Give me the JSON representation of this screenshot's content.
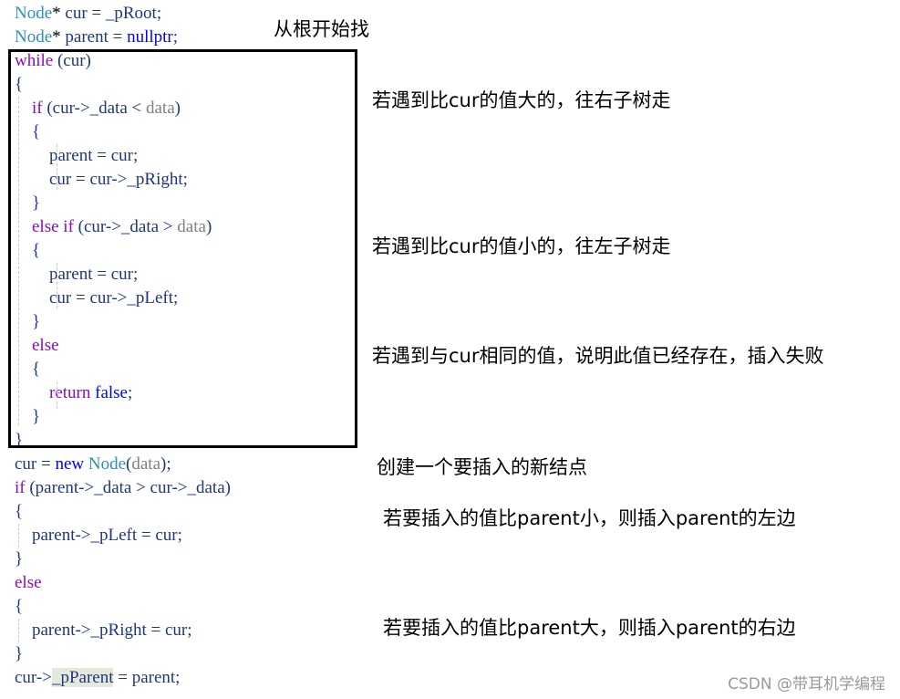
{
  "code": {
    "lines": [
      [
        {
          "t": "Node",
          "c": "ty"
        },
        {
          "t": "* ",
          "c": "pl"
        },
        {
          "t": "cur = _pRoot;",
          "c": "var"
        }
      ],
      [
        {
          "t": "Node",
          "c": "ty"
        },
        {
          "t": "* ",
          "c": "pl"
        },
        {
          "t": "parent = ",
          "c": "var"
        },
        {
          "t": "nullptr",
          "c": "bl"
        },
        {
          "t": ";",
          "c": "var"
        }
      ],
      [
        {
          "t": "while",
          "c": "kw"
        },
        {
          "t": " (cur)",
          "c": "var"
        }
      ],
      [
        {
          "t": "{",
          "c": "var"
        }
      ],
      [
        {
          "t": "    "
        },
        {
          "t": "if",
          "c": "kw"
        },
        {
          "t": " (cur->_data < ",
          "c": "var"
        },
        {
          "t": "data",
          "c": "gr"
        },
        {
          "t": ")",
          "c": "var"
        }
      ],
      [
        {
          "t": "    {",
          "c": "var"
        }
      ],
      [
        {
          "t": "        parent = cur;",
          "c": "var"
        }
      ],
      [
        {
          "t": "        cur = cur->_pRight;",
          "c": "var"
        }
      ],
      [
        {
          "t": "    }",
          "c": "var"
        }
      ],
      [
        {
          "t": "    "
        },
        {
          "t": "else if",
          "c": "kw"
        },
        {
          "t": " (cur->_data > ",
          "c": "var"
        },
        {
          "t": "data",
          "c": "gr"
        },
        {
          "t": ")",
          "c": "var"
        }
      ],
      [
        {
          "t": "    {",
          "c": "var"
        }
      ],
      [
        {
          "t": "        parent = cur;",
          "c": "var"
        }
      ],
      [
        {
          "t": "        cur = cur->_pLeft;",
          "c": "var"
        }
      ],
      [
        {
          "t": "    }",
          "c": "var"
        }
      ],
      [
        {
          "t": "    "
        },
        {
          "t": "else",
          "c": "kw"
        }
      ],
      [
        {
          "t": "    {",
          "c": "var"
        }
      ],
      [
        {
          "t": "        "
        },
        {
          "t": "return",
          "c": "kw"
        },
        {
          "t": " "
        },
        {
          "t": "false",
          "c": "bl"
        },
        {
          "t": ";",
          "c": "var"
        }
      ],
      [
        {
          "t": "    }",
          "c": "var"
        }
      ],
      [
        {
          "t": "}",
          "c": "var"
        }
      ],
      [
        {
          "t": "cur = ",
          "c": "var"
        },
        {
          "t": "new",
          "c": "bl"
        },
        {
          "t": " "
        },
        {
          "t": "Node",
          "c": "ty"
        },
        {
          "t": "(",
          "c": "var"
        },
        {
          "t": "data",
          "c": "gr"
        },
        {
          "t": ");",
          "c": "var"
        }
      ],
      [
        {
          "t": "if",
          "c": "kw"
        },
        {
          "t": " (parent->_data > cur->_data)",
          "c": "var"
        }
      ],
      [
        {
          "t": "{",
          "c": "var"
        }
      ],
      [
        {
          "t": "    parent->_pLeft = cur;",
          "c": "var"
        }
      ],
      [
        {
          "t": "}",
          "c": "var"
        }
      ],
      [
        {
          "t": "else",
          "c": "kw"
        }
      ],
      [
        {
          "t": "{",
          "c": "var"
        }
      ],
      [
        {
          "t": "    parent->_pRight = cur;",
          "c": "var"
        }
      ],
      [
        {
          "t": "}",
          "c": "var"
        }
      ],
      [
        {
          "t": "cur->",
          "c": "var"
        },
        {
          "t": "_pParent",
          "c": "var hl"
        },
        {
          "t": " = parent;",
          "c": "var"
        }
      ]
    ]
  },
  "annotations": {
    "start_from_root": "从根开始找",
    "go_right": "若遇到比cur的值大的，往右子树走",
    "go_left": "若遇到比cur的值小的，往左子树走",
    "duplicate": "若遇到与cur相同的值，说明此值已经存在，插入失败",
    "create_node": "创建一个要插入的新结点",
    "insert_left": "若要插入的值比parent小，则插入parent的左边",
    "insert_right": "若要插入的值比parent大，则插入parent的右边"
  },
  "watermark": "CSDN @带耳机学编程"
}
